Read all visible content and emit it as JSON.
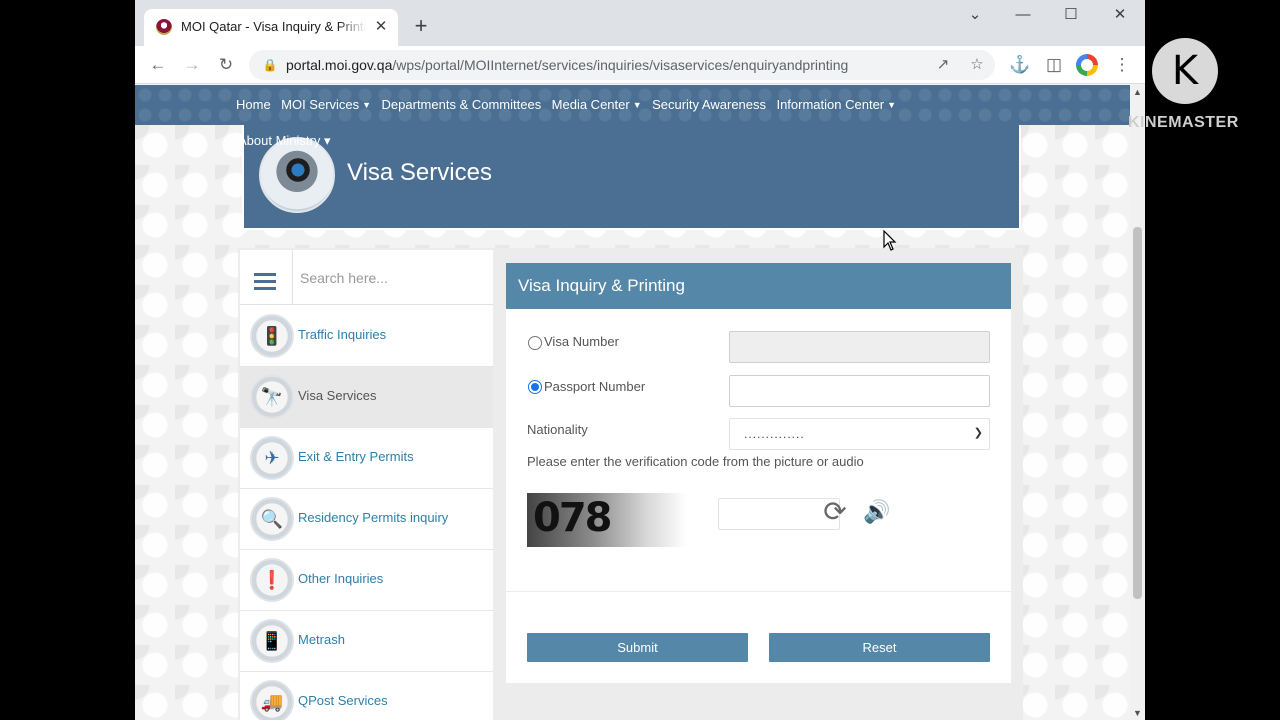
{
  "browser": {
    "tab_title": "MOI Qatar - Visa Inquiry & Printing",
    "tab_close": "✕",
    "new_tab": "+",
    "url_host": "portal.moi.gov.qa",
    "url_path": "/wps/portal/MOIInternet/services/inquiries/visaservices/enquiryandprinting",
    "window_controls": {
      "dropdown": "⌄",
      "minimize": "—",
      "maximize": "☐",
      "close": "✕"
    }
  },
  "nav": {
    "items": [
      {
        "label": "Home",
        "caret": ""
      },
      {
        "label": "MOI Services",
        "caret": "▼"
      },
      {
        "label": "Departments & Committees",
        "caret": ""
      },
      {
        "label": "Media Center",
        "caret": "▼"
      },
      {
        "label": "Security Awareness",
        "caret": ""
      },
      {
        "label": "Information Center",
        "caret": "▼"
      }
    ],
    "about": "About Ministry ▾"
  },
  "banner": {
    "title": "Visa Services"
  },
  "sidebar": {
    "search_placeholder": "Search here...",
    "items": [
      {
        "label": "Traffic Inquiries",
        "icon": "traffic-light-icon",
        "glyph": "🚦"
      },
      {
        "label": "Visa Services",
        "icon": "binoculars-icon",
        "glyph": "🔭"
      },
      {
        "label": "Exit & Entry Permits",
        "icon": "airplane-icon",
        "glyph": "✈"
      },
      {
        "label": "Residency Permits inquiry",
        "icon": "magnifier-icon",
        "glyph": "🔍"
      },
      {
        "label": "Other Inquiries",
        "icon": "exclamation-icon",
        "glyph": "❗"
      },
      {
        "label": "Metrash",
        "icon": "phone-icon",
        "glyph": "📱"
      },
      {
        "label": "QPost Services",
        "icon": "truck-icon",
        "glyph": "🚚"
      }
    ]
  },
  "form": {
    "title": "Visa Inquiry & Printing",
    "visa_number_label": "Visa Number",
    "passport_number_label": "Passport Number",
    "nationality_label": "Nationality",
    "nationality_value": "..............",
    "verification_text": "Please enter the verification code from the picture or audio",
    "captcha_code": "078",
    "refresh_glyph": "⟳",
    "speaker_glyph": "🔊",
    "submit_label": "Submit",
    "reset_label": "Reset"
  },
  "watermark": {
    "logo_letter": "K",
    "text": "KINEMASTER"
  }
}
